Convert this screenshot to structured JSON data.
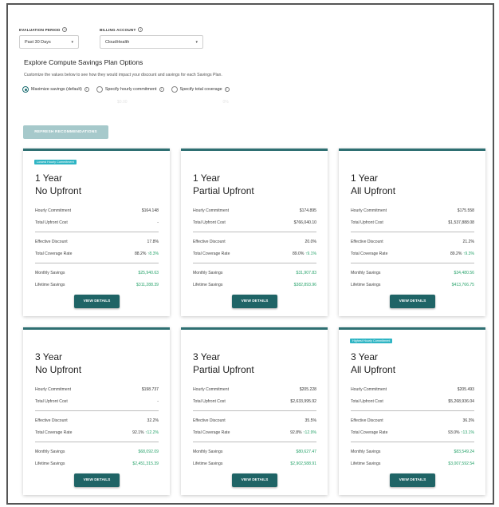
{
  "filters": {
    "evaluation_period": {
      "label": "EVALUATION PERIOD",
      "value": "Past 30 Days"
    },
    "billing_account": {
      "label": "BILLING ACCOUNT",
      "value": "CloudHealth"
    }
  },
  "heading": "Explore Compute Savings Plan Options",
  "subtext": "Customize the values below to see how they would impact your discount and savings for each Savings Plan.",
  "options": {
    "maximize": "Maximize savings (default)",
    "hourly": "Specify hourly commitment",
    "total": "Specify total coverage"
  },
  "faded": {
    "left": "$0.00",
    "right": "0%"
  },
  "refresh_label": "REFRESH RECOMMENDATIONS",
  "labels": {
    "hourly_commitment": "Hourly Commitment",
    "total_upfront_cost": "Total Upfront Cost",
    "effective_discount": "Effective Discount",
    "total_coverage_rate": "Total Coverage Rate",
    "monthly_savings": "Monthly Savings",
    "lifetime_savings": "Lifetime Savings",
    "view_details": "VIEW DETAILS"
  },
  "cards": [
    {
      "badge": "Lowest Hourly Commitment",
      "term": "1 Year",
      "plan": "No Upfront",
      "hourly": "$164.148",
      "upfront": "-",
      "discount": "17.8%",
      "coverage": "88.2%",
      "coverage_delta": "8.3%",
      "monthly": "$25,940.63",
      "lifetime": "$311,288.39"
    },
    {
      "badge": "",
      "term": "1 Year",
      "plan": "Partial Upfront",
      "hourly": "$174.895",
      "upfront": "$766,040.10",
      "discount": "20.0%",
      "coverage": "89.0%",
      "coverage_delta": "9.1%",
      "monthly": "$31,907.83",
      "lifetime": "$382,893.96"
    },
    {
      "badge": "",
      "term": "1 Year",
      "plan": "All Upfront",
      "hourly": "$175.558",
      "upfront": "$1,537,888.08",
      "discount": "21.2%",
      "coverage": "89.2%",
      "coverage_delta": "9.3%",
      "monthly": "$34,480.56",
      "lifetime": "$413,766.75"
    },
    {
      "badge": "",
      "term": "3 Year",
      "plan": "No Upfront",
      "hourly": "$198.737",
      "upfront": "-",
      "discount": "32.2%",
      "coverage": "92.1%",
      "coverage_delta": "12.2%",
      "monthly": "$68,092.09",
      "lifetime": "$2,451,315.39"
    },
    {
      "badge": "",
      "term": "3 Year",
      "plan": "Partial Upfront",
      "hourly": "$205.228",
      "upfront": "$2,633,995.92",
      "discount": "35.5%",
      "coverage": "92.8%",
      "coverage_delta": "12.9%",
      "monthly": "$80,627.47",
      "lifetime": "$2,902,588.91"
    },
    {
      "badge": "Highest Hourly Commitment",
      "term": "3 Year",
      "plan": "All Upfront",
      "hourly": "$205.493",
      "upfront": "$5,268,936.04",
      "discount": "36.3%",
      "coverage": "93.0%",
      "coverage_delta": "13.1%",
      "monthly": "$83,549.24",
      "lifetime": "$3,007,592.54"
    }
  ]
}
